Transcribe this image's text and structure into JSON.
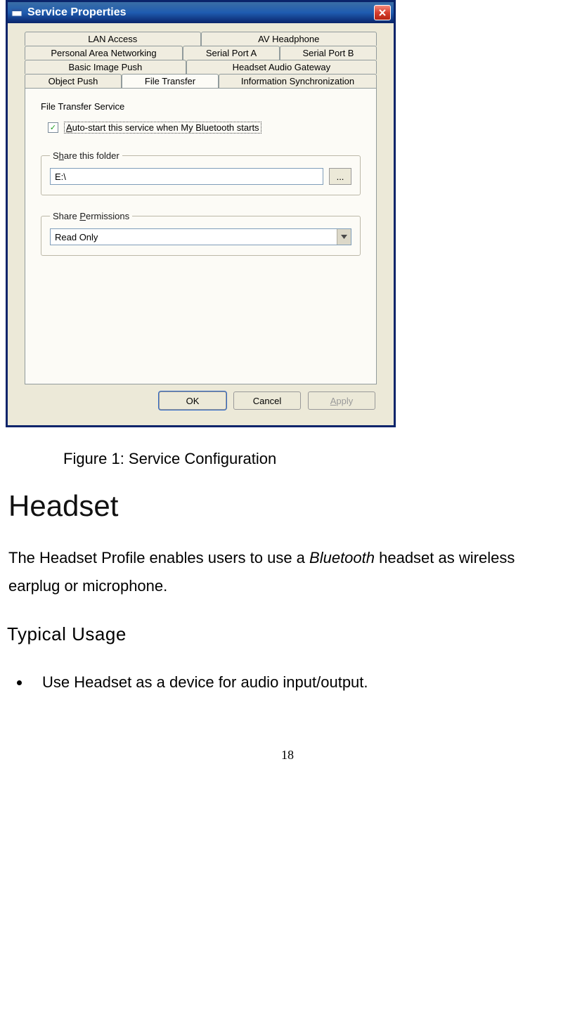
{
  "dialog": {
    "title": "Service Properties",
    "close": "X",
    "tabs": {
      "row1": [
        {
          "label": "LAN Access"
        },
        {
          "label": "AV Headphone"
        }
      ],
      "row2": [
        {
          "label": "Personal Area Networking"
        },
        {
          "label": "Serial Port A"
        },
        {
          "label": "Serial Port B"
        }
      ],
      "row3": [
        {
          "label": "Basic Image Push"
        },
        {
          "label": "Headset Audio Gateway"
        }
      ],
      "row4": [
        {
          "label": "Object Push"
        },
        {
          "label": "File Transfer"
        },
        {
          "label": "Information Synchronization"
        }
      ]
    },
    "panel": {
      "service_label": "File Transfer Service",
      "autostart_label": "Auto-start this service when My Bluetooth starts",
      "autostart_checked": "✓",
      "share_folder_legend_pre": "S",
      "share_folder_legend_u": "h",
      "share_folder_legend_post": "are this folder",
      "folder_value": "E:\\",
      "browse_label": "...",
      "perm_legend_pre": "Share ",
      "perm_legend_u": "P",
      "perm_legend_post": "ermissions",
      "perm_value": "Read Only"
    },
    "buttons": {
      "ok": "OK",
      "cancel": "Cancel",
      "apply_u": "A",
      "apply_post": "pply"
    }
  },
  "doc": {
    "caption": "Figure 1: Service Configuration",
    "h1": "Headset",
    "para_pre": "The Headset Profile enables users to use a ",
    "para_italic": "Bluetooth",
    "para_post": " headset as wireless earplug or microphone.",
    "h2": "Typical Usage",
    "bullet1": "Use Headset as a device for audio input/output.",
    "pagenum": "18"
  }
}
